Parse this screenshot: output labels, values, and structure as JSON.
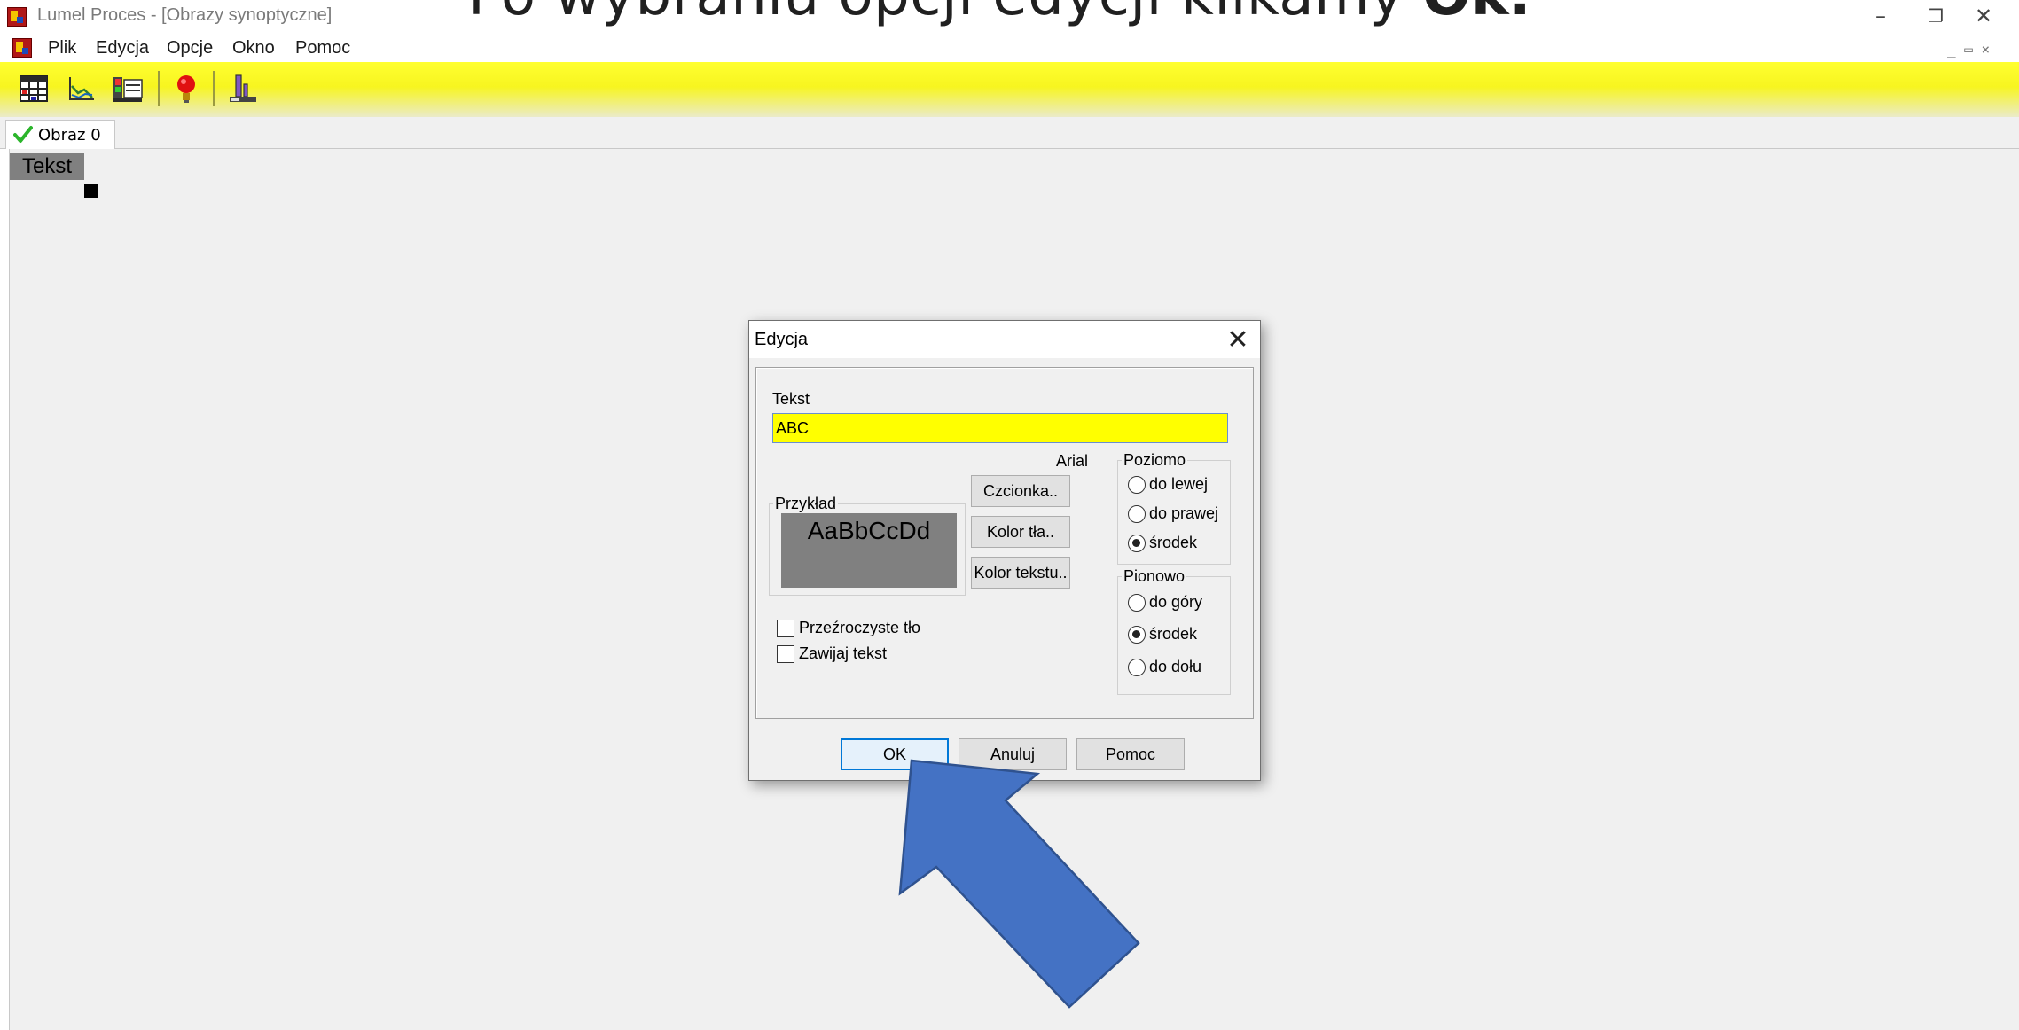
{
  "window": {
    "title": "Lumel Proces - [Obrazy synoptyczne]",
    "controls": {
      "minimize": "–",
      "restore": "❐",
      "close": "✕"
    },
    "mdi_controls": "_ ▭ ×"
  },
  "slide_heading": {
    "prefix": "Po wybraniu opcji edycji klikamy ",
    "emphasis": "Ok."
  },
  "menu": {
    "items": [
      "Plik",
      "Edycja",
      "Opcje",
      "Okno",
      "Pomoc"
    ]
  },
  "toolbar": {
    "buttons": [
      "table-grid-icon",
      "chart-icon",
      "meter-icon",
      "alarm-bulb-icon",
      "process-icon"
    ]
  },
  "tabs": [
    {
      "label": "Obraz 0",
      "status_icon": "checkmark-icon"
    }
  ],
  "canvas": {
    "text_element": "Tekst"
  },
  "dialog": {
    "title": "Edycja",
    "text_label": "Tekst",
    "text_value": "ABC",
    "font_name": "Arial",
    "example_group": "Przykład",
    "example_text": "AaBbCcDd",
    "buttons": {
      "font": "Czcionka..",
      "bg_color": "Kolor tła..",
      "text_color": "Kolor tekstu.."
    },
    "horizontal": {
      "label": "Poziomo",
      "options": [
        "do lewej",
        "do prawej",
        "środek"
      ],
      "selected": "środek"
    },
    "vertical": {
      "label": "Pionowo",
      "options": [
        "do góry",
        "środek",
        "do dołu"
      ],
      "selected": "środek"
    },
    "checkboxes": [
      {
        "label": "Przeźroczyste tło",
        "checked": false
      },
      {
        "label": "Zawijaj tekst",
        "checked": false
      }
    ],
    "footer": {
      "ok": "OK",
      "cancel": "Anuluj",
      "help": "Pomoc"
    }
  },
  "colors": {
    "toolbar_yellow": "#ffff30",
    "input_highlight": "#ffff00",
    "arrow_fill": "#4472c4",
    "arrow_stroke": "#2f528f",
    "default_button_border": "#0078d7"
  }
}
